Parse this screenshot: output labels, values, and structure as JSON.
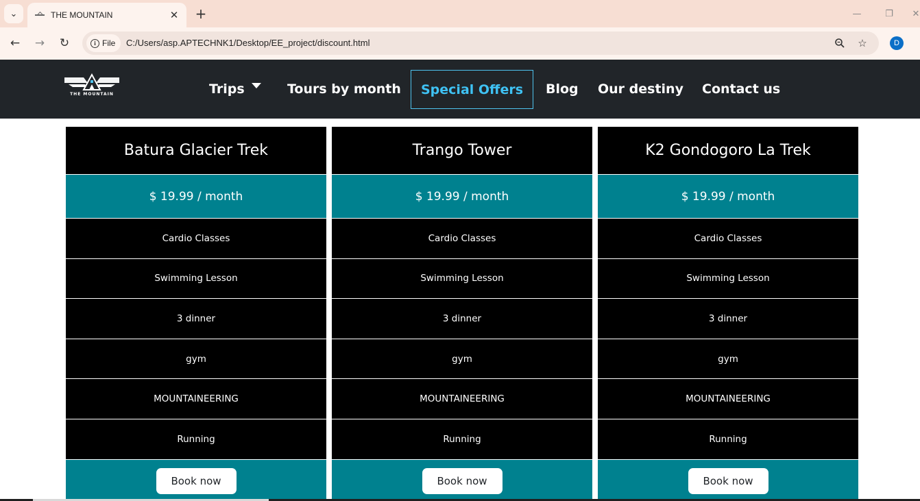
{
  "browser": {
    "tab_title": "THE MOUNTAIN",
    "chip_label": "File",
    "url": "C:/Users/asp.APTECHNK1/Desktop/EE_project/discount.html",
    "profile_initial": "D",
    "icons": {
      "tab_menu": "chevron-down-icon",
      "tab_close": "close-icon",
      "new_tab": "plus-icon",
      "back": "arrow-left-icon",
      "forward": "arrow-right-icon",
      "reload": "reload-icon",
      "site_info": "info-icon",
      "zoom": "zoom-icon",
      "bookmark": "star-icon",
      "minimize": "minimize-icon",
      "restore": "restore-icon",
      "close_window": "close-window-icon"
    }
  },
  "site_nav": {
    "logo_text": "THE MOUNTAIN",
    "items": [
      {
        "label": "Trips",
        "has_dropdown": true
      },
      {
        "label": "Tours by month"
      },
      {
        "label": "Special Offers",
        "active": true
      },
      {
        "label": "Blog"
      },
      {
        "label": "Our destiny"
      },
      {
        "label": "Contact us"
      }
    ]
  },
  "colors": {
    "navbar_bg": "#212529",
    "active_link": "#3fc2f4",
    "card_bg": "#000000",
    "accent_teal": "#00818f",
    "tab_bar_bg": "#f7ded3"
  },
  "cards": [
    {
      "title": "Batura Glacier Trek",
      "price": "$ 19.99 / month",
      "features": [
        "Cardio Classes",
        "Swimming Lesson",
        "3 dinner",
        "gym",
        "MOUNTAINEERING",
        "Running"
      ],
      "button": "Book now"
    },
    {
      "title": "Trango Tower",
      "price": "$ 19.99 / month",
      "features": [
        "Cardio Classes",
        "Swimming Lesson",
        "3 dinner",
        "gym",
        "MOUNTAINEERING",
        "Running"
      ],
      "button": "Book now"
    },
    {
      "title": "K2 Gondogoro La Trek",
      "price": "$ 19.99 / month",
      "features": [
        "Cardio Classes",
        "Swimming Lesson",
        "3 dinner",
        "gym",
        "MOUNTAINEERING",
        "Running"
      ],
      "button": "Book now"
    }
  ]
}
